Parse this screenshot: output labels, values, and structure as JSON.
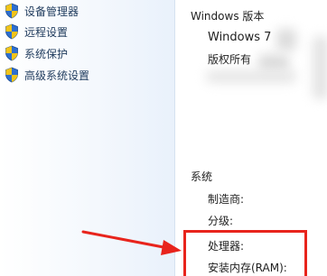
{
  "left_pane": {
    "links": [
      {
        "label": "设备管理器",
        "icon": "uac-shield-icon"
      },
      {
        "label": "远程设置",
        "icon": "uac-shield-icon"
      },
      {
        "label": "系统保护",
        "icon": "uac-shield-icon"
      },
      {
        "label": "高级系统设置",
        "icon": "uac-shield-icon"
      }
    ]
  },
  "windows_edition": {
    "heading": "Windows 版本",
    "edition": "Windows 7",
    "copyright": "版权所有"
  },
  "system": {
    "heading": "系统",
    "manufacturer_label": "制造商:",
    "rating_label": "分级:",
    "processor_label": "处理器:",
    "ram_label": "安装内存(RAM):"
  },
  "annotation": {
    "color": "#e8241c"
  },
  "colors": {
    "link_text": "#1e3a5c",
    "shield_blue": "#2e6fcf",
    "shield_yellow": "#f2c418"
  }
}
